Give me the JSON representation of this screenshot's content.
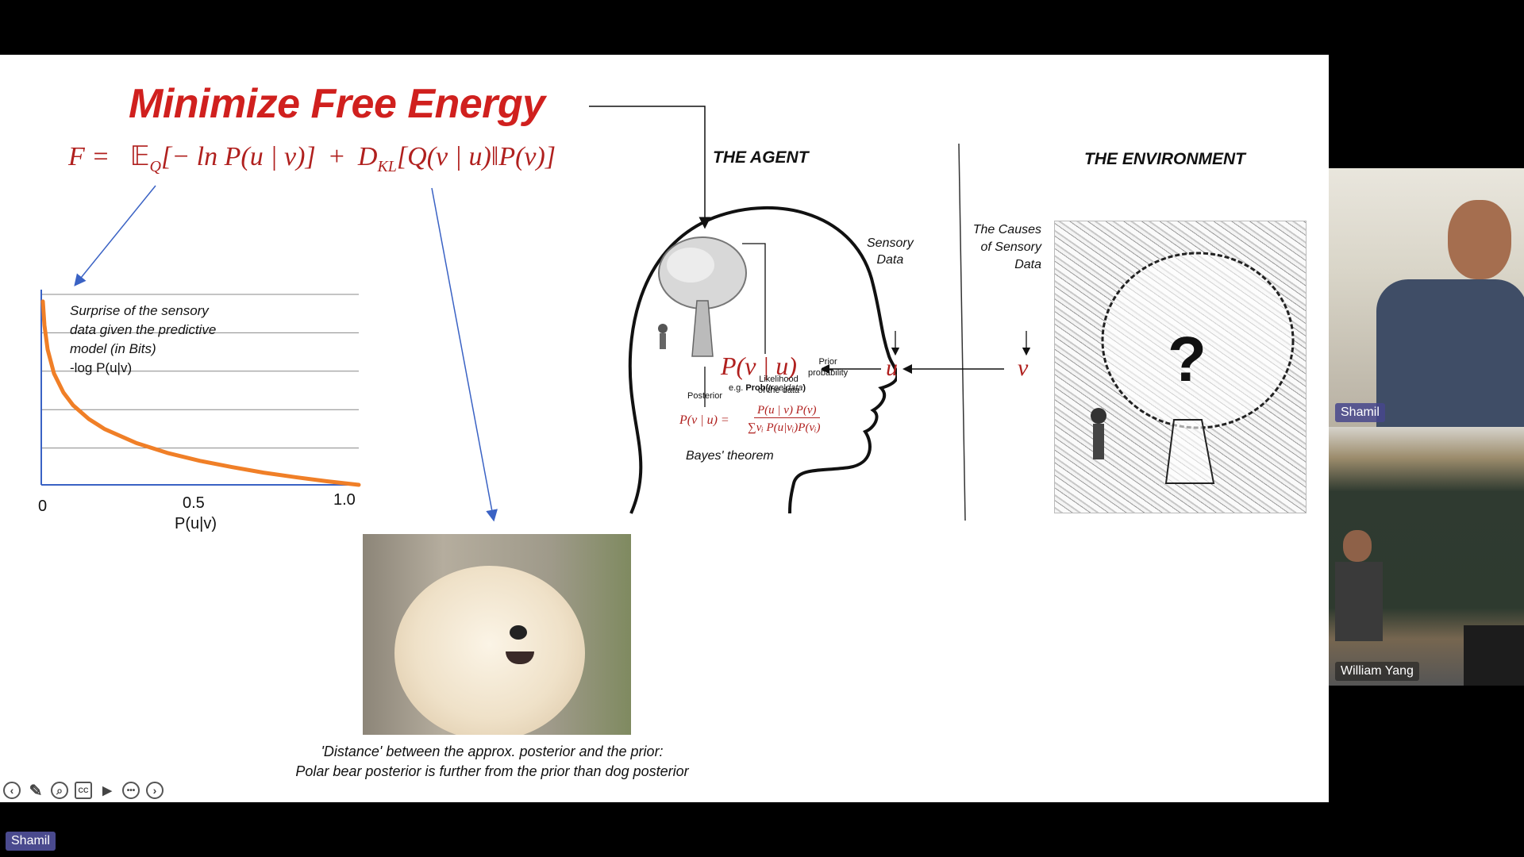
{
  "slide": {
    "title": "Minimize Free Energy",
    "formula": "F =   𝔼_Q[− ln P(u | v)]  +  D_KL[Q(v | u)‖P(v)]",
    "formula_parts": {
      "lhs": "F =",
      "term1": "𝔼",
      "term1_sub": "Q",
      "term1_body": "[− ln P(u | v)]",
      "plus": "+",
      "term2": "D",
      "term2_sub": "KL",
      "term2_body": "[Q(v | u)‖P(v)]"
    },
    "agent_header": "THE AGENT",
    "environment_header": "THE ENVIRONMENT",
    "sensory_data_label_1": "Sensory",
    "sensory_data_label_2": "Data",
    "causes_label_1": "The Causes",
    "causes_label_2": "of Sensory",
    "causes_label_3": "Data",
    "posterior_expr": "P(v | u)",
    "eg_prefix": "e.g.",
    "eg_prob": "Prob(",
    "eg_args": "tree|data",
    "eg_close": ")",
    "u_symbol": "u",
    "v_symbol": "v",
    "posterior_label": "Posterior",
    "likelihood_label_1": "Likelihood",
    "likelihood_label_2": "of the data",
    "prior_label_1": "Prior",
    "prior_label_2": "probability",
    "bayes_lhs": "P(v | u) =",
    "bayes_num": "P(u | v)  P(v)",
    "bayes_den": "∑vᵢ P(u|vᵢ)P(vᵢ)",
    "bayes_caption": "Bayes' theorem",
    "question_mark": "?",
    "graph_text_1": "Surprise of the sensory",
    "graph_text_2": "data given the predictive",
    "graph_text_3": "model (in Bits)",
    "graph_text_4": "-log P(u|v)",
    "dog_caption_1": "'Distance' between the approx. posterior and the prior:",
    "dog_caption_2": "Polar bear posterior is further from the prior than dog posterior"
  },
  "chart_data": {
    "type": "line",
    "x_ticks": [
      "0",
      "0.5",
      "1.0"
    ],
    "xlabel": "P(u|v)",
    "ylabel": "",
    "title": "",
    "series": [
      {
        "x": [
          0.005,
          0.01,
          0.02,
          0.04,
          0.07,
          0.1,
          0.15,
          0.2,
          0.3,
          0.4,
          0.5,
          0.6,
          0.7,
          0.8,
          0.9,
          1.0
        ],
        "y": [
          7.64,
          6.64,
          5.64,
          4.64,
          3.84,
          3.32,
          2.74,
          2.32,
          1.74,
          1.32,
          1.0,
          0.74,
          0.51,
          0.32,
          0.15,
          0.0
        ]
      }
    ],
    "xlim": [
      0,
      1
    ],
    "ylim": [
      0,
      8
    ],
    "line_color": "#f07f27",
    "axis_color": "#3a62c4"
  },
  "toolbar": {
    "icons": [
      "back-icon",
      "pen-icon",
      "zoom-icon",
      "captions-icon",
      "video-off-icon",
      "more-icon",
      "forward-icon"
    ]
  },
  "participants": [
    {
      "name": "Shamil"
    },
    {
      "name": "William Yang"
    }
  ],
  "screen_share_label": "Shamil",
  "colors": {
    "accent_red": "#d0201e",
    "nametag": "#46468c",
    "arrow_blue": "#3a62c4"
  }
}
